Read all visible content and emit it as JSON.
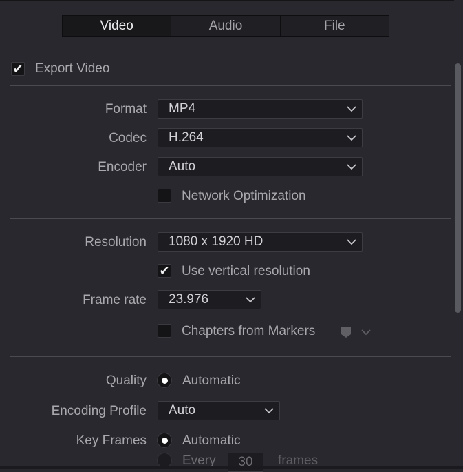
{
  "tabs": {
    "video": "Video",
    "audio": "Audio",
    "file": "File"
  },
  "export_video": {
    "label": "Export Video",
    "checked": true
  },
  "format": {
    "label": "Format",
    "value": "MP4"
  },
  "codec": {
    "label": "Codec",
    "value": "H.264"
  },
  "encoder": {
    "label": "Encoder",
    "value": "Auto"
  },
  "network_optimization": {
    "label": "Network Optimization",
    "checked": false
  },
  "resolution": {
    "label": "Resolution",
    "value": "1080 x 1920 HD"
  },
  "vertical_resolution": {
    "label": "Use vertical resolution",
    "checked": true
  },
  "frame_rate": {
    "label": "Frame rate",
    "value": "23.976"
  },
  "chapters": {
    "label": "Chapters from Markers",
    "checked": false
  },
  "quality": {
    "label": "Quality",
    "option": "Automatic"
  },
  "encoding_profile": {
    "label": "Encoding Profile",
    "value": "Auto"
  },
  "key_frames": {
    "label": "Key Frames",
    "option_auto": "Automatic",
    "every_label": "Every",
    "every_value": "30",
    "frames_label": "frames"
  },
  "icons": {
    "check": "checkmark-icon",
    "dropdown": "chevron-down-icon",
    "marker": "marker-icon"
  }
}
